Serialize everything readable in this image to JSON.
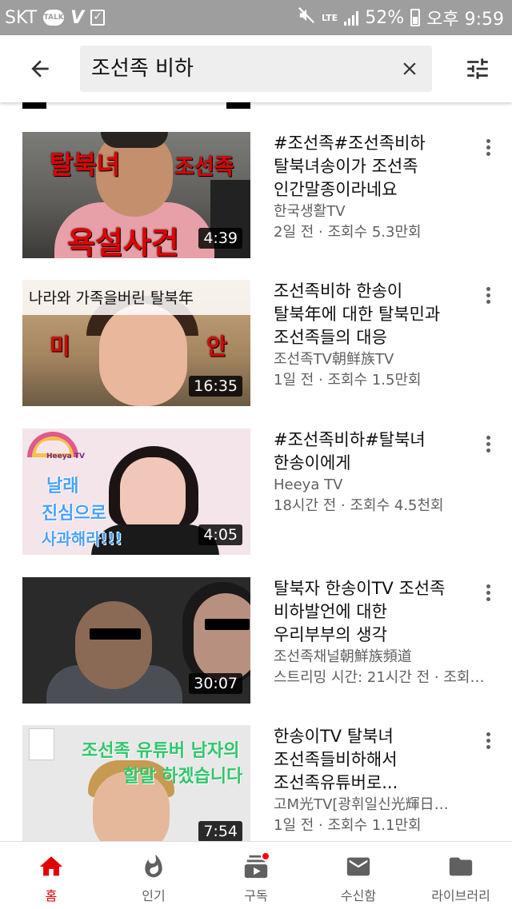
{
  "status_bar": {
    "carrier": "SKT",
    "talk_icon_text": "TALK",
    "battery": "52%",
    "time": "오후 9:59",
    "network": "LTE"
  },
  "search": {
    "query": "조선족 비하",
    "icons": {
      "back": "arrow-back-icon",
      "clear": "close-icon",
      "filter": "tune-icon"
    }
  },
  "videos": [
    {
      "title_lines": [
        "#조선족#조선족비하",
        "탈북녀송이가 조선족",
        "인간말종이라네요"
      ],
      "channel": "한국생활TV",
      "meta": "2일 전 · 조회수 5.3만회",
      "duration": "4:39",
      "thumb_text": [
        "탈북녀",
        "조선족",
        "욕설사건"
      ]
    },
    {
      "title_lines": [
        "조선족비하 한송이",
        "탈북年에 대한 탈북민과",
        "조선족들의 대응"
      ],
      "channel": "조선족TV朝鲜族TV",
      "meta": "1일 전 · 조회수 1.5만회",
      "duration": "16:35",
      "thumb_text": [
        "나라와 가족을버린 탈북年",
        "미",
        "안"
      ]
    },
    {
      "title_lines": [
        "#조선족비하#탈북녀",
        "한송이에게"
      ],
      "channel": "Heeya TV",
      "meta": "18시간 전 · 조회수 4.5천회",
      "duration": "4:05",
      "thumb_text": [
        "Heeya TV",
        "날래",
        "진심으로",
        "사과해라!!!"
      ]
    },
    {
      "title_lines": [
        "탈북자 한송이TV 조선족",
        "비하발언에 대한",
        "우리부부의 생각"
      ],
      "channel": "조선족채널朝鮮族頻道",
      "meta": "스트리밍 시간: 21시간 전 · 조회…",
      "duration": "30:07",
      "thumb_text": []
    },
    {
      "title_lines": [
        "한송이TV 탈북녀",
        "조선족들비하해서",
        "조선족유튜버로..."
      ],
      "channel": "고M光TV[광휘일신光輝日…",
      "meta": "1일 전 · 조회수 1.1만회",
      "duration": "7:54",
      "thumb_text": [
        "조선족 유튜버 남자의",
        "할말 하겠습니다"
      ]
    }
  ],
  "bottom_nav": [
    {
      "label": "홈",
      "icon": "home-icon",
      "active": true
    },
    {
      "label": "인기",
      "icon": "trending-flame-icon",
      "active": false
    },
    {
      "label": "구독",
      "icon": "subscriptions-icon",
      "active": false,
      "has_notification": true
    },
    {
      "label": "수신함",
      "icon": "inbox-mail-icon",
      "active": false
    },
    {
      "label": "라이브러리",
      "icon": "library-folder-icon",
      "active": false
    }
  ],
  "colors": {
    "accent_red": "#e00000",
    "status_bar_bg": "#9e9e9e",
    "search_box_bg": "#eeeeee",
    "secondary_text": "#606060"
  }
}
